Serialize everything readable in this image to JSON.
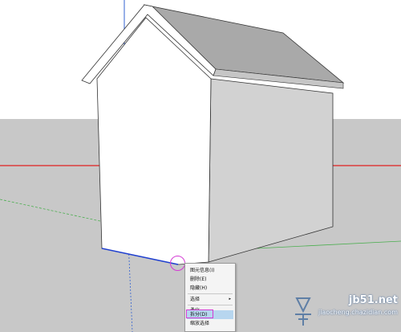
{
  "scene": {
    "sky_color": "#ffffff",
    "ground_color": "#c8c8c8",
    "red_axis_color": "#e02020",
    "green_axis_color": "#4caf50",
    "blue_axis_color": "#3060d0",
    "roof_color": "#a9a9a9",
    "front_wall_color": "#ffffff",
    "side_wall_color": "#d2d2d2"
  },
  "context_menu": {
    "items": [
      {
        "label": "图元信息(I)",
        "has_submenu": false,
        "highlighted": false
      },
      {
        "label": "删除(E)",
        "has_submenu": false,
        "highlighted": false
      },
      {
        "label": "隐藏(H)",
        "has_submenu": false,
        "highlighted": false
      },
      {
        "label": "选择",
        "has_submenu": true,
        "highlighted": false
      },
      {
        "label": "柔化",
        "has_submenu": false,
        "highlighted": false
      },
      {
        "label": "拆分(D)",
        "has_submenu": false,
        "highlighted": true
      },
      {
        "label": "缩放选择",
        "has_submenu": false,
        "highlighted": false
      }
    ],
    "submenu_arrow": "▸"
  },
  "annotations": {
    "highlight_color": "#d43bd4",
    "arrow_color": "#8b1a1a"
  },
  "watermark": {
    "line1": "jb51.net",
    "line2": "jiaocheng.chazidian.com",
    "icon": "watermark-logo-icon"
  }
}
